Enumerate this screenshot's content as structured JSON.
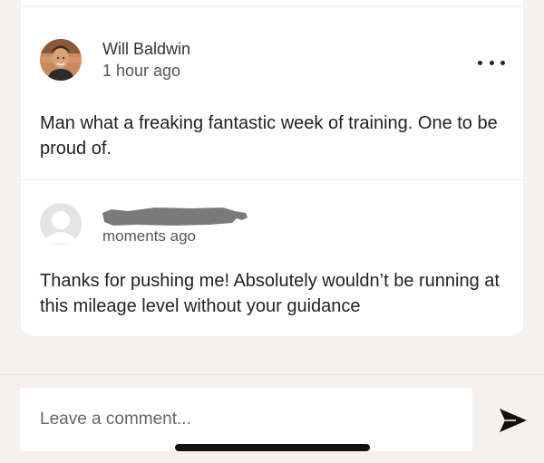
{
  "comments": [
    {
      "author": "Will Baldwin",
      "timestamp": "1 hour ago",
      "body": "Man what a freaking fantastic week of training. One to be proud of.",
      "avatar_icon": "user-photo"
    },
    {
      "author": "",
      "timestamp": "moments ago",
      "body": "Thanks for pushing me! Absolutely wouldn’t be running at this mileage level without your guidance",
      "avatar_icon": "default-avatar-icon"
    }
  ],
  "more_icon": "more-dots-icon",
  "comment_box": {
    "placeholder": "Leave a comment...",
    "send_icon": "send-icon"
  },
  "colors": {
    "background": "#f4f1ee",
    "card": "#ffffff",
    "text": "#222222",
    "redaction": "#7a7a7a"
  }
}
